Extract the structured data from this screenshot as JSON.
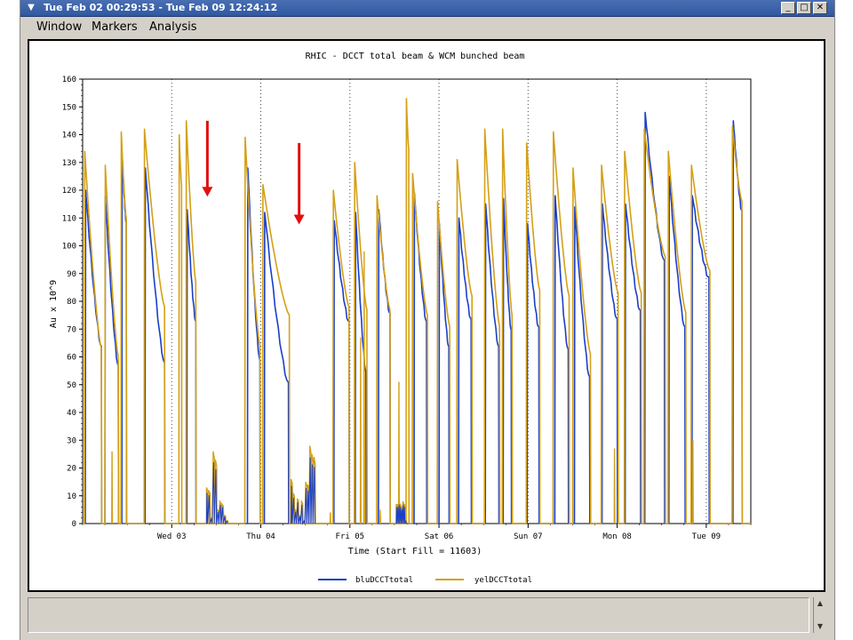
{
  "window": {
    "title": "Tue Feb 02 00:29:53 - Tue Feb 09 12:24:12",
    "menu": [
      "Window",
      "Markers",
      "Analysis"
    ]
  },
  "colors": {
    "blu": "#1a3fc8",
    "yel": "#d4a017",
    "arrow": "#e01010"
  },
  "chart_data": {
    "type": "line",
    "title": "RHIC  -  DCCT total beam & WCM bunched beam",
    "xlabel": "Time (Start Fill = 11603)",
    "ylabel": "Au x 10^9",
    "x_tick_labels": [
      "Wed 03",
      "Thu 04",
      "Fri 05",
      "Sat 06",
      "Sun 07",
      "Mon 08",
      "Tue 09"
    ],
    "xlim": [
      "Tue Feb 02 00:29:53",
      "Tue Feb 09 12:24:12"
    ],
    "ylim": [
      0,
      160
    ],
    "yticks": [
      0,
      10,
      20,
      30,
      40,
      50,
      60,
      70,
      80,
      90,
      100,
      110,
      120,
      130,
      140,
      150,
      160
    ],
    "legend": [
      "bluDCCTtotal",
      "yelDCCTtotal"
    ],
    "legend_position": "bottom",
    "x_units": "days since Tue Feb 02 00:00",
    "day_dividers": [
      1,
      2,
      3,
      4,
      5,
      6,
      7
    ],
    "series": [
      {
        "name": "bluDCCTtotal",
        "fills": [
          {
            "t0": 0.03,
            "t1": 0.21,
            "v0": 120,
            "v1": 63
          },
          {
            "t0": 0.25,
            "t1": 0.4,
            "v0": 118,
            "v1": 56
          },
          {
            "t0": 0.44,
            "t1": 0.49,
            "v0": 133,
            "v1": 108
          },
          {
            "t0": 0.7,
            "t1": 0.92,
            "v0": 128,
            "v1": 57
          },
          {
            "t0": 1.17,
            "t1": 1.27,
            "v0": 113,
            "v1": 72
          },
          {
            "t0": 1.85,
            "t1": 1.99,
            "v0": 128,
            "v1": 58
          },
          {
            "t0": 2.04,
            "t1": 2.31,
            "v0": 112,
            "v1": 50
          },
          {
            "t0": 2.82,
            "t1": 2.99,
            "v0": 109,
            "v1": 72
          },
          {
            "t0": 3.06,
            "t1": 3.18,
            "v0": 112,
            "v1": 54
          },
          {
            "t0": 3.32,
            "t1": 3.45,
            "v0": 113,
            "v1": 75
          },
          {
            "t0": 3.72,
            "t1": 3.86,
            "v0": 119,
            "v1": 72
          },
          {
            "t0": 4.0,
            "t1": 4.11,
            "v0": 108,
            "v1": 63
          },
          {
            "t0": 4.22,
            "t1": 4.36,
            "v0": 110,
            "v1": 73
          },
          {
            "t0": 4.52,
            "t1": 4.67,
            "v0": 115,
            "v1": 63
          },
          {
            "t0": 4.72,
            "t1": 4.81,
            "v0": 117,
            "v1": 69
          },
          {
            "t0": 4.99,
            "t1": 5.12,
            "v0": 108,
            "v1": 70
          },
          {
            "t0": 5.3,
            "t1": 5.45,
            "v0": 118,
            "v1": 62
          },
          {
            "t0": 5.52,
            "t1": 5.69,
            "v0": 114,
            "v1": 52
          },
          {
            "t0": 5.83,
            "t1": 6.0,
            "v0": 115,
            "v1": 73
          },
          {
            "t0": 6.09,
            "t1": 6.26,
            "v0": 115,
            "v1": 76
          },
          {
            "t0": 6.31,
            "t1": 6.53,
            "v0": 148,
            "v1": 94
          },
          {
            "t0": 6.58,
            "t1": 6.76,
            "v0": 125,
            "v1": 70
          },
          {
            "t0": 6.84,
            "t1": 7.03,
            "v0": 118,
            "v1": 88
          },
          {
            "t0": 7.3,
            "t1": 7.4,
            "v0": 145,
            "v1": 112
          }
        ]
      },
      {
        "name": "yelDCCTtotal",
        "fills": [
          {
            "t0": 0.02,
            "t1": 0.21,
            "v0": 134,
            "v1": 63
          },
          {
            "t0": 0.25,
            "t1": 0.4,
            "v0": 129,
            "v1": 60
          },
          {
            "t0": 0.43,
            "t1": 0.49,
            "v0": 141,
            "v1": 110
          },
          {
            "t0": 0.69,
            "t1": 0.92,
            "v0": 142,
            "v1": 78
          },
          {
            "t0": 1.08,
            "t1": 1.11,
            "v0": 140,
            "v1": 122
          },
          {
            "t0": 1.16,
            "t1": 1.27,
            "v0": 145,
            "v1": 87
          },
          {
            "t0": 1.82,
            "t1": 1.99,
            "v0": 139,
            "v1": 64
          },
          {
            "t0": 2.02,
            "t1": 2.32,
            "v0": 122,
            "v1": 75
          },
          {
            "t0": 2.81,
            "t1": 2.99,
            "v0": 120,
            "v1": 78
          },
          {
            "t0": 3.05,
            "t1": 3.19,
            "v0": 130,
            "v1": 77
          },
          {
            "t0": 3.3,
            "t1": 3.45,
            "v0": 118,
            "v1": 77
          },
          {
            "t0": 3.63,
            "t1": 3.66,
            "v0": 153,
            "v1": 135
          },
          {
            "t0": 3.7,
            "t1": 3.87,
            "v0": 126,
            "v1": 75
          },
          {
            "t0": 3.98,
            "t1": 4.12,
            "v0": 116,
            "v1": 71
          },
          {
            "t0": 4.2,
            "t1": 4.37,
            "v0": 131,
            "v1": 82
          },
          {
            "t0": 4.51,
            "t1": 4.68,
            "v0": 142,
            "v1": 71
          },
          {
            "t0": 4.71,
            "t1": 4.82,
            "v0": 142,
            "v1": 75
          },
          {
            "t0": 4.98,
            "t1": 5.13,
            "v0": 137,
            "v1": 84
          },
          {
            "t0": 5.28,
            "t1": 5.46,
            "v0": 141,
            "v1": 82
          },
          {
            "t0": 5.5,
            "t1": 5.7,
            "v0": 128,
            "v1": 61
          },
          {
            "t0": 5.82,
            "t1": 6.01,
            "v0": 129,
            "v1": 83
          },
          {
            "t0": 6.08,
            "t1": 6.27,
            "v0": 134,
            "v1": 83
          },
          {
            "t0": 6.3,
            "t1": 6.54,
            "v0": 142,
            "v1": 96
          },
          {
            "t0": 6.57,
            "t1": 6.77,
            "v0": 134,
            "v1": 76
          },
          {
            "t0": 6.83,
            "t1": 7.04,
            "v0": 129,
            "v1": 91
          },
          {
            "t0": 7.29,
            "t1": 7.4,
            "v0": 143,
            "v1": 116
          }
        ]
      }
    ],
    "spikes": [
      {
        "t": 0.33,
        "v": 26,
        "series": "yelDCCTtotal"
      },
      {
        "t": 2.78,
        "v": 4,
        "series": "yelDCCTtotal"
      },
      {
        "t": 3.34,
        "v": 5,
        "series": "yelDCCTtotal"
      },
      {
        "t": 3.55,
        "v": 51,
        "series": "yelDCCTtotal"
      },
      {
        "t": 3.12,
        "v": 67,
        "series": "yelDCCTtotal"
      },
      {
        "t": 3.16,
        "v": 98,
        "series": "yelDCCTtotal"
      },
      {
        "t": 5.97,
        "v": 27,
        "series": "yelDCCTtotal"
      },
      {
        "t": 6.85,
        "v": 30,
        "series": "yelDCCTtotal"
      }
    ],
    "low_activity": [
      {
        "t0": 1.39,
        "t1": 1.64,
        "levels": [
          13,
          12,
          2,
          26,
          23,
          5,
          8,
          7,
          3,
          1
        ]
      },
      {
        "t0": 2.34,
        "t1": 2.62,
        "levels": [
          16,
          11,
          5,
          9,
          3,
          8,
          1,
          15,
          14,
          28,
          25,
          24
        ]
      },
      {
        "t0": 3.52,
        "t1": 3.64,
        "levels": [
          7,
          7,
          8,
          7,
          6,
          8,
          7,
          1
        ]
      }
    ],
    "annotations": [
      {
        "type": "arrow",
        "t": 1.4,
        "y_from": 145,
        "y_to": 118,
        "color": "red"
      },
      {
        "type": "arrow",
        "t": 2.43,
        "y_from": 137,
        "y_to": 108,
        "color": "red"
      }
    ]
  }
}
